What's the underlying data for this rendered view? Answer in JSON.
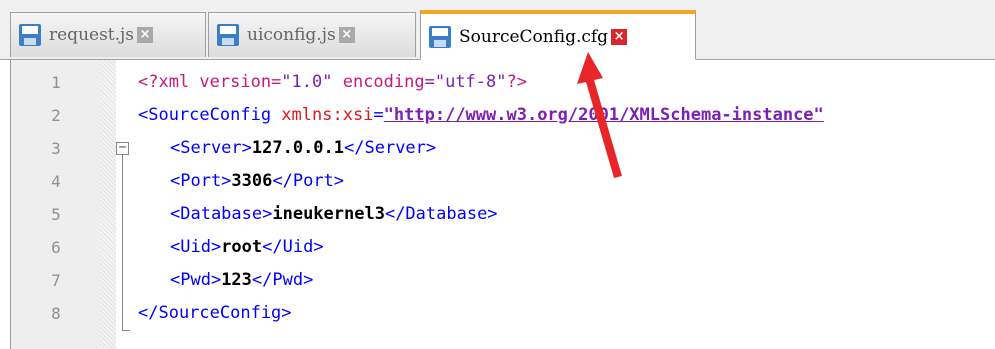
{
  "tabs": [
    {
      "label": "request.js",
      "active": false
    },
    {
      "label": "uiconfig.js",
      "active": false
    },
    {
      "label": "SourceConfig.cfg",
      "active": true
    }
  ],
  "tab_close_glyph": "×",
  "fold_glyph": "−",
  "line_numbers": [
    "1",
    "2",
    "3",
    "4",
    "5",
    "6",
    "7",
    "8"
  ],
  "code": {
    "line1": {
      "open": "<?xml version=",
      "version": "\"1.0\"",
      "mid": " encoding",
      "enc": "=\"utf-8\"",
      "close": "?>"
    },
    "line2": {
      "tag": "<SourceConfig",
      "attr": " xmlns:xsi",
      "eq": "=",
      "url": "\"http://www.w3.org/2001/XMLSchema-instance\""
    },
    "server": {
      "open": "<Server>",
      "value": "127.0.0.1",
      "close": "</Server>"
    },
    "port": {
      "open": "<Port>",
      "value": "3306",
      "close": "</Port>"
    },
    "database": {
      "open": "<Database>",
      "value": "ineukernel3",
      "close": "</Database>"
    },
    "uid": {
      "open": "<Uid>",
      "value": "root",
      "close": "</Uid>"
    },
    "pwd": {
      "open": "<Pwd>",
      "value": "123",
      "close": "</Pwd>"
    },
    "line8": {
      "close": "</SourceConfig>"
    }
  },
  "colors": {
    "active_tab_accent": "#f5a623",
    "close_active": "#d9262b",
    "tag": "#0000ff",
    "attr": "#e0161b",
    "string": "#7c1fb5",
    "annotation_arrow": "#e8262a"
  },
  "icons": {
    "tab_file": "save-icon",
    "tab_close": "close-icon",
    "fold": "fold-minus-icon"
  }
}
